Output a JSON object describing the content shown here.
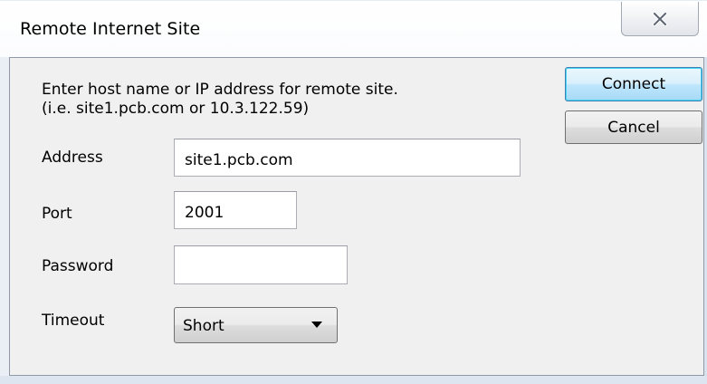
{
  "window": {
    "title": "Remote Internet Site",
    "close_icon": "close-icon"
  },
  "instructions": {
    "line1": "Enter host name or IP address for remote site.",
    "line2": "(i.e. site1.pcb.com or 10.3.122.59)"
  },
  "form": {
    "address_label": "Address",
    "address_value": "site1.pcb.com",
    "port_label": "Port",
    "port_value": "2001",
    "password_label": "Password",
    "password_value": "",
    "timeout_label": "Timeout",
    "timeout_value": "Short",
    "timeout_arrow_icon": "chevron-down-icon"
  },
  "buttons": {
    "connect_label": "Connect",
    "cancel_label": "Cancel"
  },
  "colors": {
    "default_button_border": "#3c7fb1",
    "default_button_fill": "#bee6fd",
    "dialog_background": "#f0f0f0"
  }
}
